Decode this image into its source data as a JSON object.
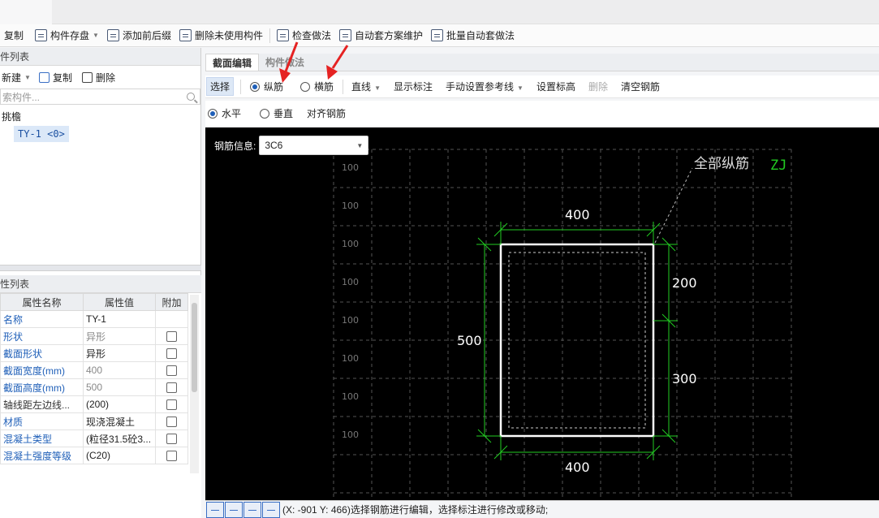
{
  "toolbar": {
    "items": [
      "复制",
      "构件存盘",
      "添加前后缀",
      "删除未使用构件",
      "检查做法",
      "自动套方案维护",
      "批量自动套做法"
    ]
  },
  "component_list": {
    "title": "件列表",
    "new_label": "新建",
    "copy_label": "复制",
    "delete_label": "删除",
    "search_placeholder": "索构件...",
    "tree_root": "挑檐",
    "tree_child": "TY-1 <0>"
  },
  "property_list": {
    "title": "性列表",
    "headers": [
      "属性名称",
      "属性值",
      "附加"
    ],
    "rows": [
      {
        "name": "名称",
        "value": "TY-1",
        "extra": false
      },
      {
        "name": "形状",
        "value": "异形",
        "extra": true
      },
      {
        "name": "截面形状",
        "value": "异形",
        "extra": true
      },
      {
        "name": "截面宽度(mm)",
        "value": "400",
        "extra": true
      },
      {
        "name": "截面高度(mm)",
        "value": "500",
        "extra": true
      },
      {
        "name": "轴线距左边线...",
        "value": "(200)",
        "extra": true
      },
      {
        "name": "材质",
        "value": "现浇混凝土",
        "extra": true
      },
      {
        "name": "混凝土类型",
        "value": "(粒径31.5砼3...",
        "extra": true
      },
      {
        "name": "混凝土强度等级",
        "value": "(C20)",
        "extra": true
      }
    ]
  },
  "tabs": {
    "section_edit": "截面编辑",
    "component_method": "构件做法"
  },
  "edit_toolbar": {
    "select": "选择",
    "longitudinal": "纵筋",
    "transverse": "横筋",
    "line": "直线",
    "show_dim": "显示标注",
    "manual_ref": "手动设置参考线",
    "set_elev": "设置标高",
    "delete": "删除",
    "clear": "清空钢筋"
  },
  "align_toolbar": {
    "horizontal": "水平",
    "vertical": "垂直",
    "align": "对齐钢筋"
  },
  "canvas": {
    "rebar_info_label": "钢筋信息:",
    "rebar_value": "3C6",
    "grid_label": "100",
    "dim_top": "400",
    "dim_bottom": "400",
    "dim_left": "500",
    "dim_right_top": "200",
    "dim_right_bottom": "300",
    "annotation": "全部纵筋",
    "annotation_code": "ZJ"
  },
  "status": {
    "text": "(X: -901 Y: 466)选择钢筋进行编辑，选择标注进行修改或移动;"
  },
  "colors": {
    "dim_green": "#22cc22",
    "annotation_code": "#22cc22",
    "arrow_red": "#e52222",
    "accent_blue": "#1f5fb8"
  }
}
